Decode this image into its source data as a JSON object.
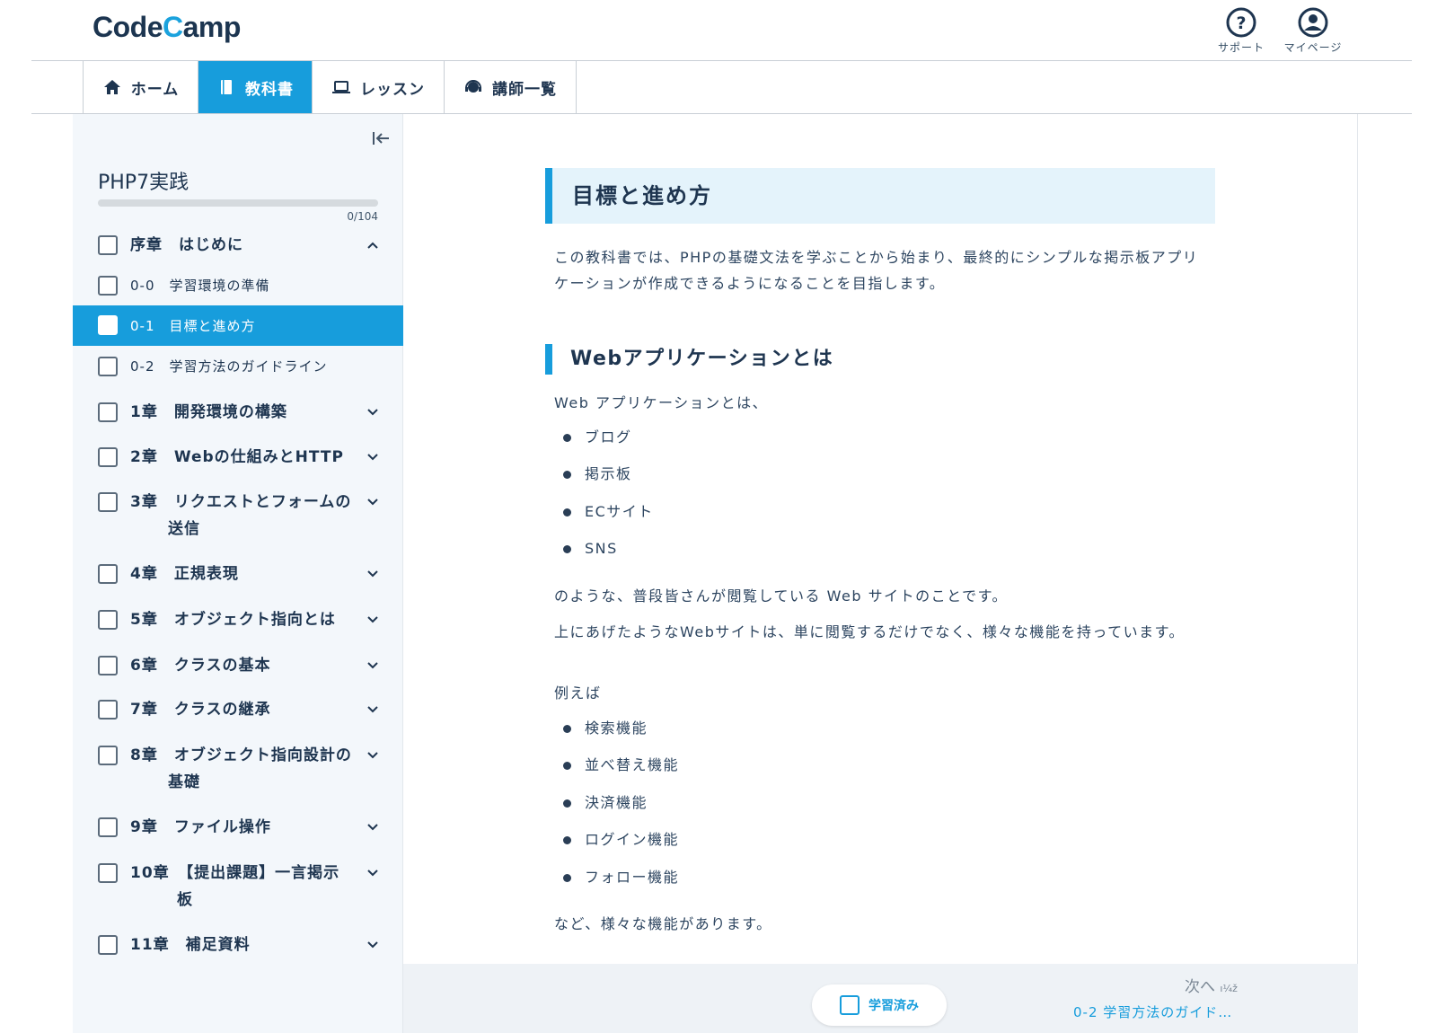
{
  "header": {
    "logo": "CodeCamp",
    "support_label": "サポート",
    "mypage_label": "マイページ"
  },
  "nav": {
    "home": "ホーム",
    "textbook": "教科書",
    "lesson": "レッスン",
    "instructors": "講師一覧"
  },
  "sidebar": {
    "course_title": "PHP7実践",
    "progress_text": "0/104",
    "progress_fraction": 0,
    "items": [
      {
        "label": "序章　はじめに",
        "type": "chapter",
        "expanded": true
      },
      {
        "label": "0-0　学習環境の準備",
        "type": "sub"
      },
      {
        "label": "0-1　目標と進め方",
        "type": "sub",
        "active": true
      },
      {
        "label": "0-2　学習方法のガイドライン",
        "type": "sub"
      },
      {
        "label": "1章　開発環境の構築",
        "type": "chapter"
      },
      {
        "label": "2章　Webの仕組みとHTTP",
        "type": "chapter"
      },
      {
        "label": "3章　リクエストとフォームの",
        "label2": "送信",
        "type": "chapter"
      },
      {
        "label": "4章　正規表現",
        "type": "chapter"
      },
      {
        "label": "5章　オブジェクト指向とは",
        "type": "chapter"
      },
      {
        "label": "6章　クラスの基本",
        "type": "chapter"
      },
      {
        "label": "7章　クラスの継承",
        "type": "chapter"
      },
      {
        "label": "8章　オブジェクト指向設計の",
        "label2": "基礎",
        "type": "chapter"
      },
      {
        "label": "9章　ファイル操作",
        "type": "chapter"
      },
      {
        "label": "10章　【提出課題】一言掲示",
        "label2": "板",
        "type": "chapter"
      },
      {
        "label": "11章　補足資料",
        "type": "chapter"
      }
    ]
  },
  "main": {
    "title": "目標と進め方",
    "intro": "この教科書では、PHPの基礎文法を学ぶことから始まり、最終的にシンプルな掲示板アプリケーションが作成できるようになることを目指します。",
    "h2": "Webアプリケーションとは",
    "p1": "Web アプリケーションとは、",
    "list1": [
      "ブログ",
      "掲示板",
      "ECサイト",
      "SNS"
    ],
    "p2": "のような、普段皆さんが閲覧している Web サイトのことです。",
    "p3": "上にあげたようなWebサイトは、単に閲覧するだけでなく、様々な機能を持っています。",
    "p4": "例えば",
    "list2": [
      "検索機能",
      "並べ替え機能",
      "決済機能",
      "ログイン機能",
      "フォロー機能"
    ],
    "p5": "など、様々な機能があります。"
  },
  "footer": {
    "done_label": "学習済み",
    "next_label": "次へ",
    "next_suffix": "ı¼ž",
    "next_link": "0-2 学習方法のガイド…"
  },
  "colors": {
    "accent": "#179ddc",
    "text": "#1e3550",
    "sidebar_bg": "#f3f7fb",
    "title_bg": "#e4f3fb"
  }
}
